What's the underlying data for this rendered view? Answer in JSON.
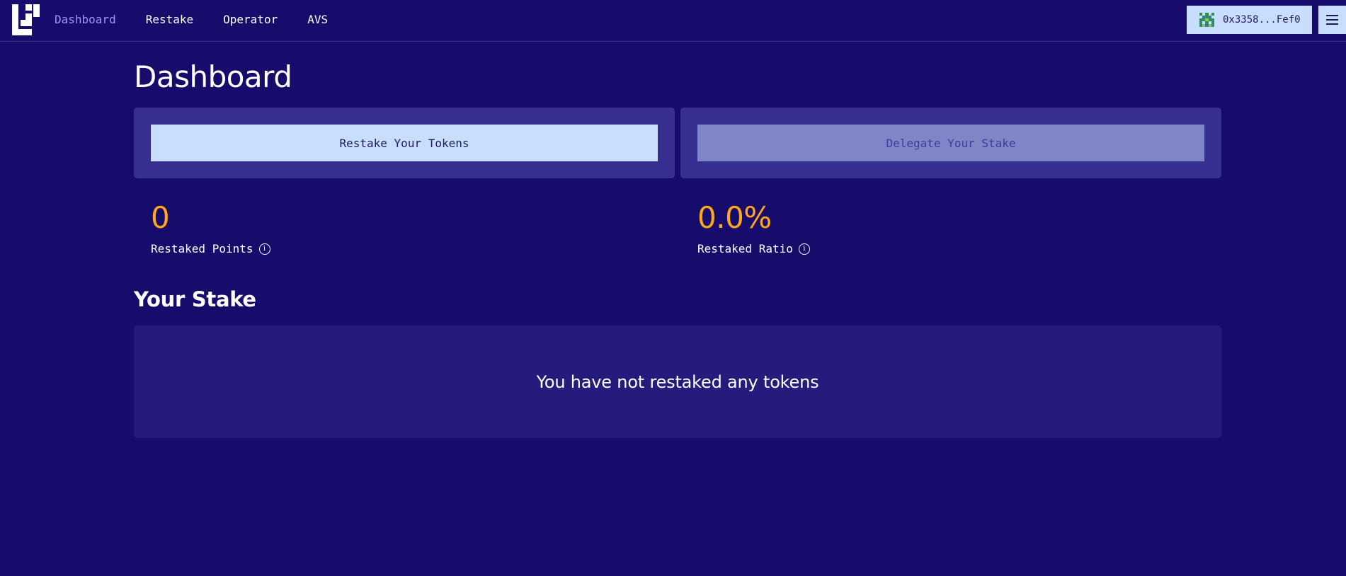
{
  "nav": {
    "items": [
      {
        "label": "Dashboard",
        "active": true
      },
      {
        "label": "Restake",
        "active": false
      },
      {
        "label": "Operator",
        "active": false
      },
      {
        "label": "AVS",
        "active": false
      }
    ]
  },
  "wallet": {
    "address": "0x3358...Fef0",
    "icon": "wallet-avatar-icon"
  },
  "menu": {
    "icon": "hamburger-menu-icon"
  },
  "page": {
    "title": "Dashboard"
  },
  "actions": {
    "restake_label": "Restake Your Tokens",
    "delegate_label": "Delegate Your Stake"
  },
  "stats": {
    "points": {
      "value": "0",
      "label": "Restaked Points"
    },
    "ratio": {
      "value": "0.0%",
      "label": "Restaked Ratio"
    }
  },
  "stake": {
    "title": "Your Stake",
    "empty_message": "You have not restaked any tokens"
  },
  "colors": {
    "background": "#170b6b",
    "card": "#383091",
    "panel": "#251b7c",
    "accent": "#ffa71a",
    "button_primary": "#c9deff",
    "nav_active": "#9d95ff"
  }
}
